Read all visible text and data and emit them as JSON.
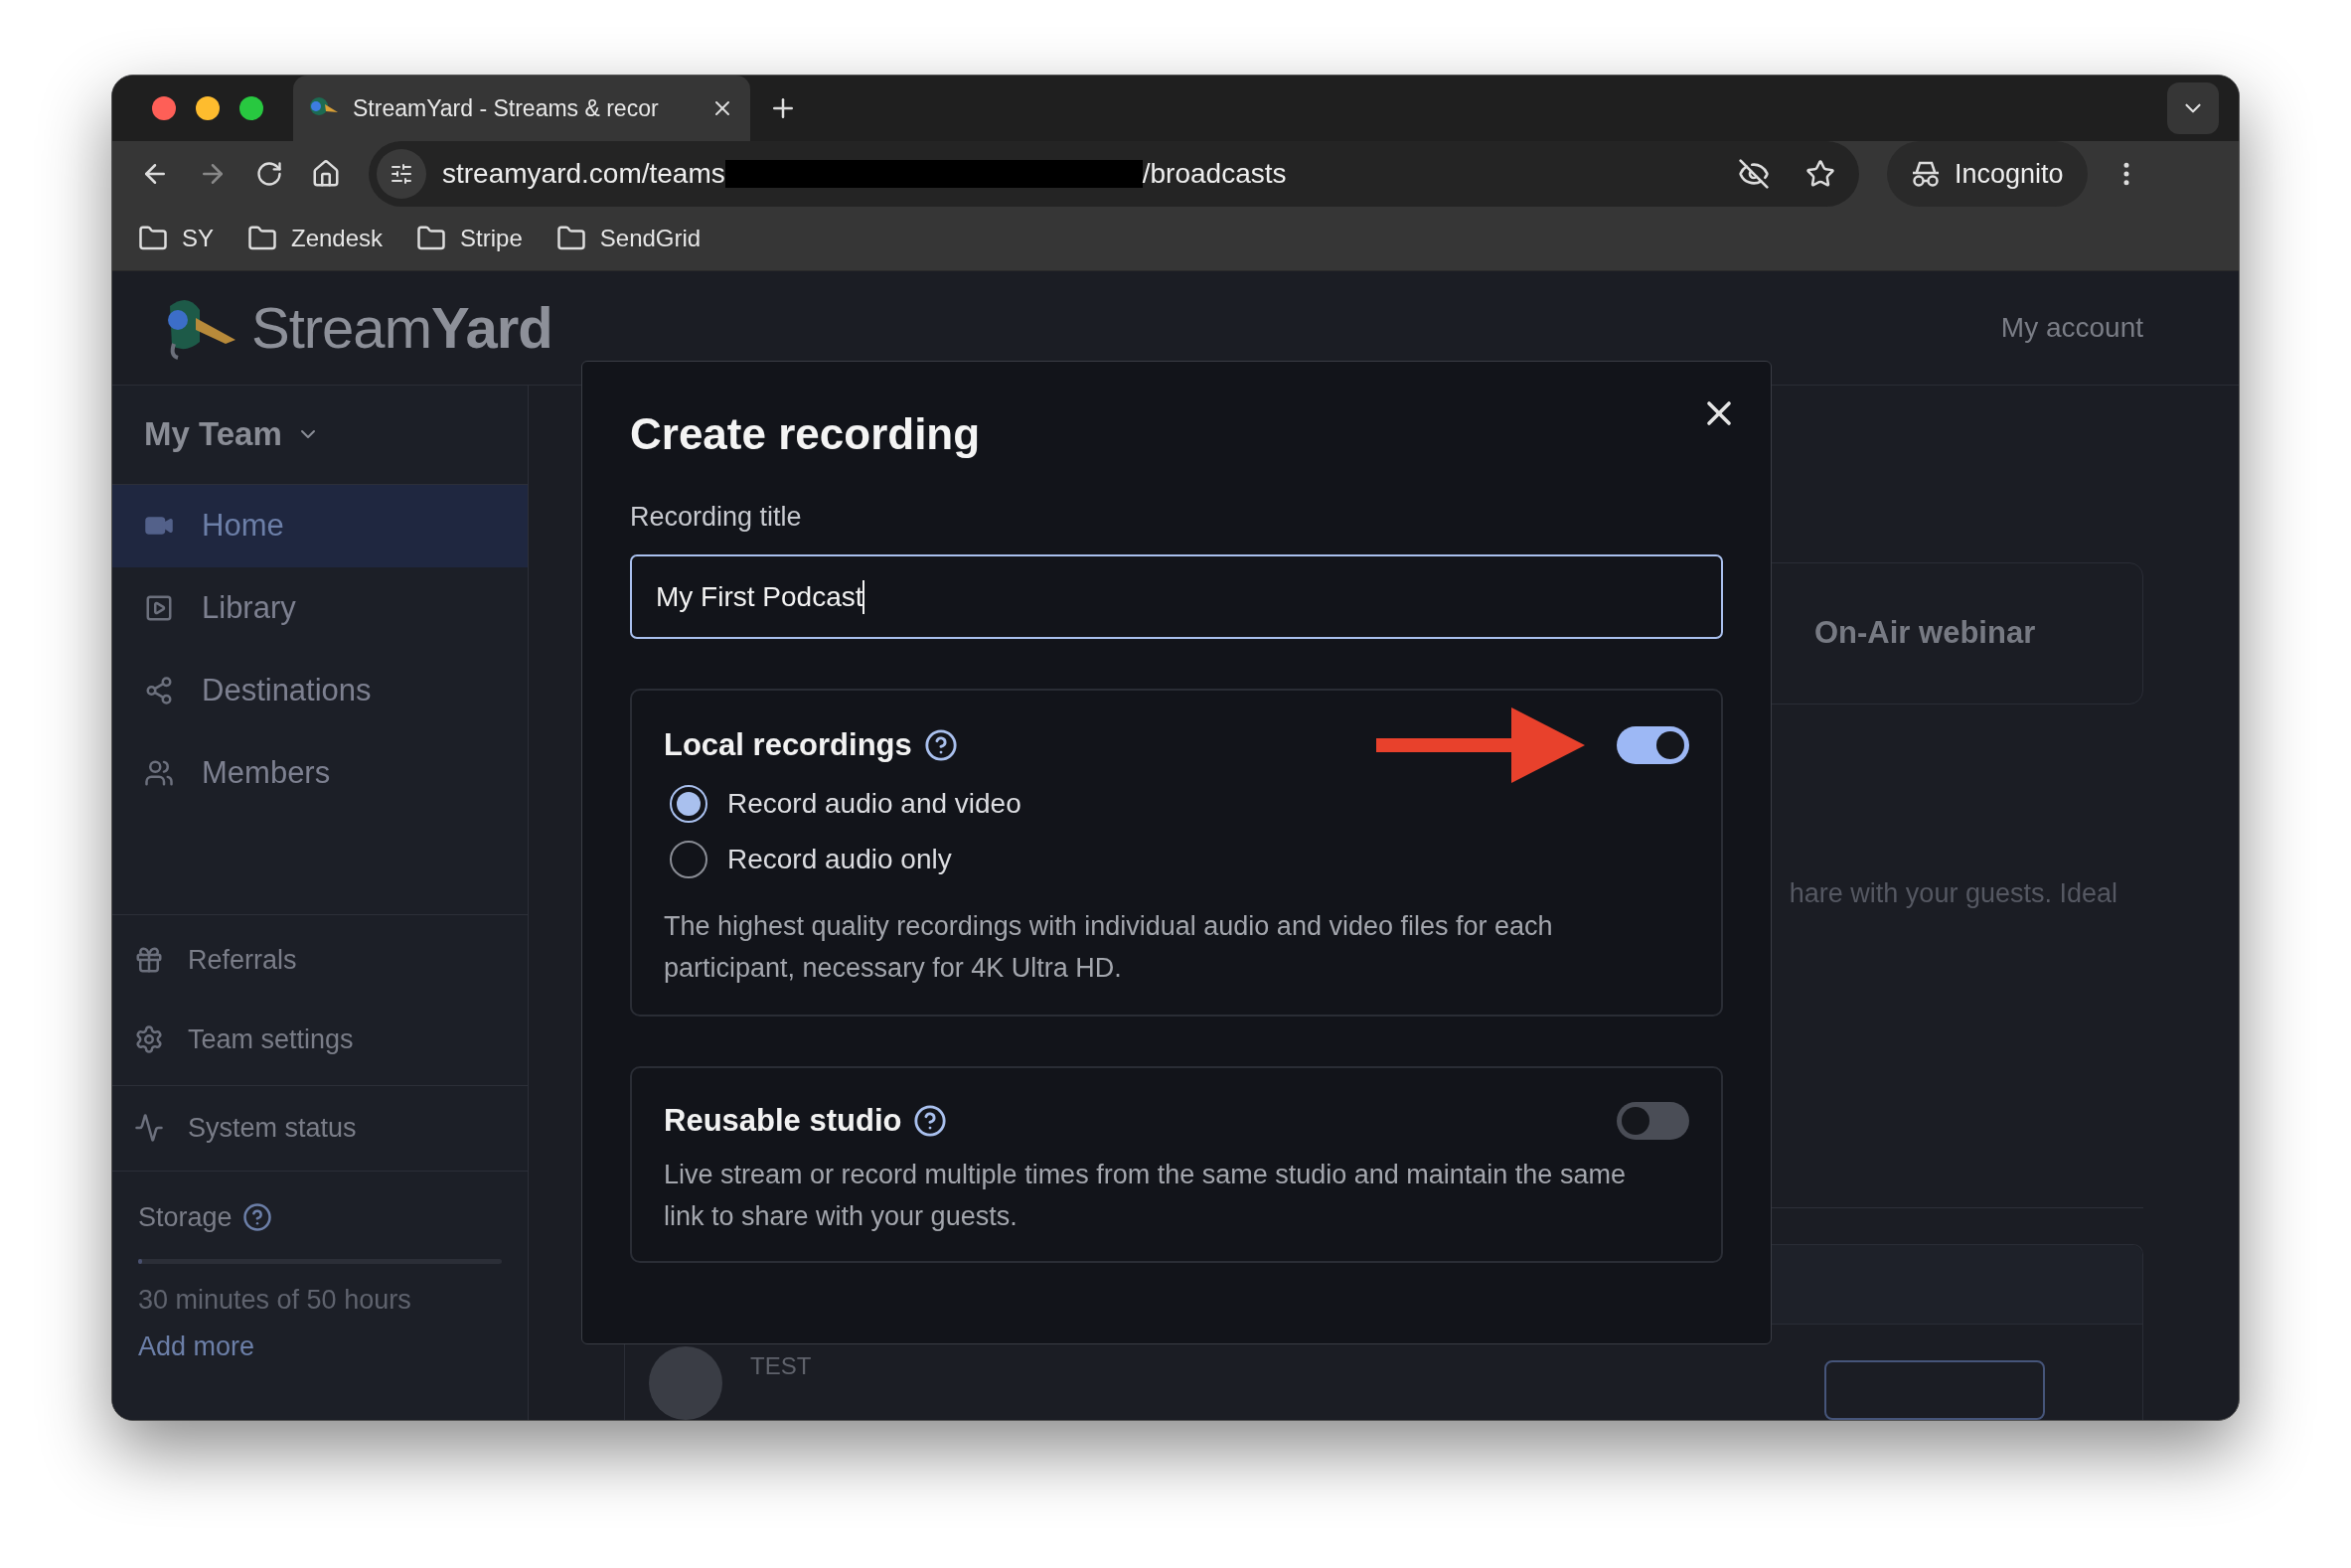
{
  "browser": {
    "tab": {
      "title": "StreamYard - Streams & recor"
    },
    "url_start": "streamyard.com/teams",
    "url_end": "/broadcasts",
    "profile": "Incognito",
    "bookmarks": [
      "SY",
      "Zendesk",
      "Stripe",
      "SendGrid"
    ]
  },
  "header": {
    "logo_light": "Stream",
    "logo_bold": "Yard",
    "account": "My account"
  },
  "sidebar": {
    "team": "My Team",
    "nav": [
      {
        "label": "Home",
        "selected": true
      },
      {
        "label": "Library",
        "selected": false
      },
      {
        "label": "Destinations",
        "selected": false
      },
      {
        "label": "Members",
        "selected": false
      }
    ],
    "links": [
      "Referrals",
      "Team settings"
    ],
    "status": "System status",
    "storage": {
      "label": "Storage",
      "level": 0.01,
      "usage": "30 minutes of 50 hours",
      "add": "Add more"
    }
  },
  "background": {
    "card_title": "On-Air webinar",
    "text": "hare with your guests. Ideal",
    "row_title": "TEST"
  },
  "modal": {
    "title": "Create recording",
    "field_label": "Recording title",
    "field_value": "My First Podcast",
    "sections": [
      {
        "title": "Local recordings",
        "on": true,
        "options": [
          {
            "label": "Record audio and video",
            "selected": true
          },
          {
            "label": "Record audio only",
            "selected": false
          }
        ],
        "description": "The highest quality recordings with individual audio and video files for each participant, necessary for 4K Ultra HD."
      },
      {
        "title": "Reusable studio",
        "on": false,
        "description": "Live stream or record multiple times from the same studio and maintain the same link to share with your guests."
      }
    ]
  }
}
